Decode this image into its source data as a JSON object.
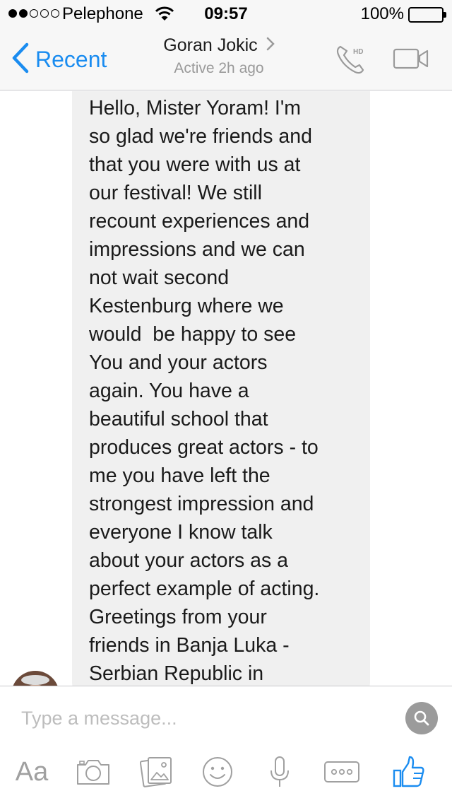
{
  "status_bar": {
    "carrier": "Pelephone",
    "time": "09:57",
    "battery": "100%"
  },
  "nav": {
    "back_label": "Recent",
    "contact_name": "Goran Jokic",
    "contact_status": "Active 2h ago",
    "call_badge": "HD"
  },
  "message": {
    "text": "Hello, Mister Yoram! I'm\nso glad we're friends and\nthat you were with us at\nour festival! We still\nrecount experiences and\nimpressions and we can\nnot wait second\nKestenburg where we\nwould  be happy to see\nYou and your actors\nagain. You have a\nbeautiful school that\nproduces great actors - to\nme you have left the\nstrongest impression and\neveryone I know talk\nabout your actors as a\nperfect example of acting.\nGreetings from your\nfriends in Banja Luka -\nSerbian Republic in"
  },
  "composer": {
    "placeholder": "Type a message...",
    "text_tool_label": "Aa"
  },
  "colors": {
    "accent": "#1a8cf0",
    "icon_gray": "#a0a0a0",
    "bubble": "#f0f0f0"
  },
  "icons": {
    "back": "chevron-left-icon",
    "chevron": "chevron-right-icon",
    "call": "phone-hd-icon",
    "video": "video-camera-icon",
    "search": "search-icon",
    "camera": "camera-icon",
    "gallery": "gallery-icon",
    "sticker": "smiley-icon",
    "voice": "microphone-icon",
    "more": "more-icon",
    "like": "thumbs-up-icon"
  }
}
